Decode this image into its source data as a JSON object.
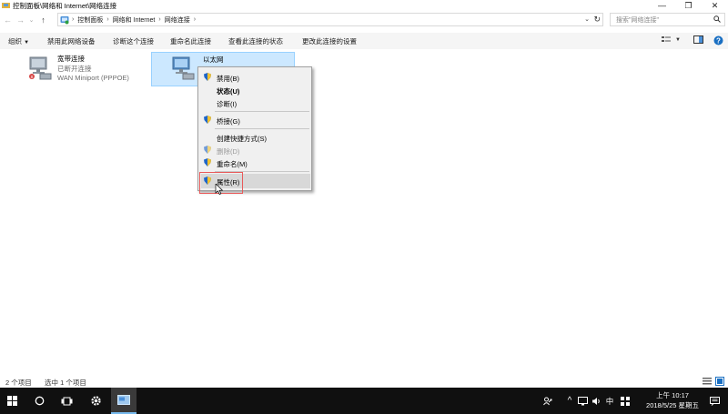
{
  "window": {
    "title": "控制面板\\网络和 Internet\\网络连接",
    "controls": {
      "minimize": "—",
      "restore": "❐",
      "close": "✕"
    }
  },
  "address": {
    "crumbs": [
      "控制面板",
      "网络和 Internet",
      "网络连接"
    ],
    "dropdown": "⌄",
    "refresh": "↻",
    "search_placeholder": "搜索\"网络连接\""
  },
  "nav": {
    "back": "←",
    "forward": "→",
    "recent": "⌄",
    "up": "↑"
  },
  "toolbar": {
    "organize": "组织",
    "disable": "禁用此网络设备",
    "diagnose": "诊断这个连接",
    "rename": "重命名此连接",
    "view_status": "查看此连接的状态",
    "change_settings": "更改此连接的设置"
  },
  "items": [
    {
      "name": "宽带连接",
      "status": "已断开连接",
      "device": "WAN Miniport (PPPOE)"
    },
    {
      "name": "以太网"
    }
  ],
  "context_menu": {
    "items": [
      {
        "label": "禁用(B)",
        "bold": false,
        "shield": true,
        "disabled": false
      },
      {
        "label": "状态(U)",
        "bold": true,
        "shield": false,
        "disabled": false
      },
      {
        "label": "诊断(I)",
        "bold": false,
        "shield": false,
        "disabled": false
      },
      {
        "label": "桥接(G)",
        "bold": false,
        "shield": true,
        "disabled": false
      },
      {
        "label": "创建快捷方式(S)",
        "bold": false,
        "shield": false,
        "disabled": false
      },
      {
        "label": "删除(D)",
        "bold": false,
        "shield": true,
        "disabled": true
      },
      {
        "label": "重命名(M)",
        "bold": false,
        "shield": true,
        "disabled": false
      },
      {
        "label": "属性(R)",
        "bold": false,
        "shield": true,
        "disabled": false
      }
    ]
  },
  "statusbar": {
    "count": "2 个项目",
    "selected": "选中 1 个项目"
  },
  "taskbar": {
    "ime": "中",
    "time": "上午 10:17",
    "date": "2018/5/25 星期五"
  },
  "colors": {
    "selection": "#cce8ff",
    "taskbar": "#101010",
    "highlight_box": "#e85a5a"
  }
}
